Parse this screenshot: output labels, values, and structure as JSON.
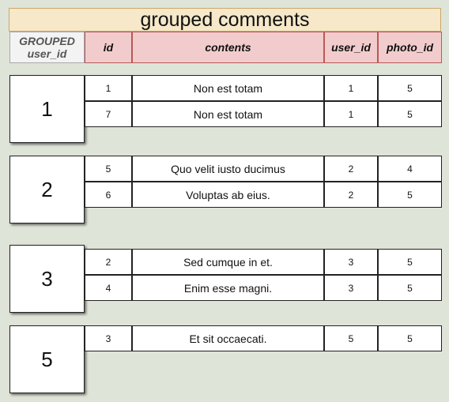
{
  "title": "grouped comments",
  "headers": {
    "grouped_line1": "GROUPED",
    "grouped_line2": "user_id",
    "id": "id",
    "contents": "contents",
    "user_id": "user_id",
    "photo_id": "photo_id"
  },
  "groups": [
    {
      "label": "1",
      "rows": [
        {
          "id": "1",
          "contents": "Non est totam",
          "user_id": "1",
          "photo_id": "5"
        },
        {
          "id": "7",
          "contents": "Non est totam",
          "user_id": "1",
          "photo_id": "5"
        }
      ]
    },
    {
      "label": "2",
      "rows": [
        {
          "id": "5",
          "contents": "Quo velit iusto ducimus",
          "user_id": "2",
          "photo_id": "4"
        },
        {
          "id": "6",
          "contents": "Voluptas ab eius.",
          "user_id": "2",
          "photo_id": "5"
        }
      ]
    },
    {
      "label": "3",
      "rows": [
        {
          "id": "2",
          "contents": "Sed cumque in et.",
          "user_id": "3",
          "photo_id": "5"
        },
        {
          "id": "4",
          "contents": "Enim esse magni.",
          "user_id": "3",
          "photo_id": "5"
        }
      ]
    },
    {
      "label": "5",
      "rows": [
        {
          "id": "3",
          "contents": "Et sit occaecati.",
          "user_id": "5",
          "photo_id": "5"
        }
      ]
    }
  ]
}
